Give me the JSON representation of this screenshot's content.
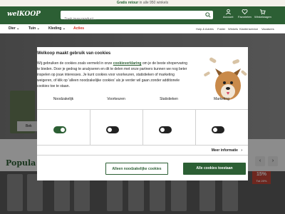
{
  "topbar": {
    "bold": "Gratis retour",
    "text": " in alle 950 winkels"
  },
  "header": {
    "logo": "welKOOP",
    "search_placeholder": "Zoek jouw product...",
    "icons": [
      {
        "name": "account-icon",
        "label": "Account"
      },
      {
        "name": "favorites-icon",
        "label": "Favorieten"
      },
      {
        "name": "cart-icon",
        "label": "Winkelwagen"
      }
    ]
  },
  "nav": {
    "items": [
      {
        "label": "Dier ⌄"
      },
      {
        "label": "Tuin ⌄"
      },
      {
        "label": "Kleding ⌄"
      },
      {
        "label": "Acties"
      }
    ],
    "sub": [
      "Hulp & Advies",
      "Folder",
      "Winkels",
      "Klantenservice",
      "Vacatures"
    ]
  },
  "background": {
    "button_label": "Bek",
    "section_title": "Popula",
    "promo_line1": "15%",
    "promo_line2": "Tot 20%"
  },
  "cookie": {
    "title": "Welkoop maakt gebruik van cookies",
    "body_pre": "Wij gebruiken de cookies zoals vermeld in onze ",
    "body_link": "cookieverklaring",
    "body_post": " om je de beste shopervaring te bieden. Door je gedrag te analyseren en dit te delen met onze partners kunnen we nog beter inspelen op jouw interesses. Je kunt cookies voor voorkeuren, statistieken of marketing weigeren, of klik op 'alleen noodzakelijke cookies' als je verder wil gaan zonder additionele cookies toe te staan.",
    "options": [
      {
        "label": "Noodzakelijk",
        "state": "on"
      },
      {
        "label": "Voorkeuren",
        "state": "off"
      },
      {
        "label": "Statistieken",
        "state": "off"
      },
      {
        "label": "Marketing",
        "state": "off"
      }
    ],
    "more_label": "Meer informatie",
    "btn_necessary": "Alleen noodzakelijke cookies",
    "btn_all": "Alle cookies toestaan",
    "accent_color": "#2c5f34"
  }
}
